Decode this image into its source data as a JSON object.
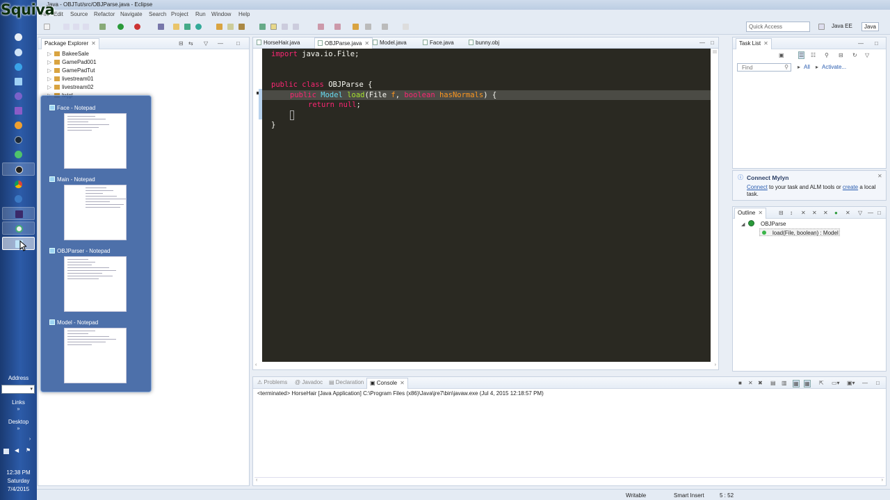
{
  "brand": "Squiva",
  "window": {
    "title": "Java - OBJTut/src/OBJParse.java - Eclipse"
  },
  "menu": [
    "File",
    "Edit",
    "Source",
    "Refactor",
    "Navigate",
    "Search",
    "Project",
    "Run",
    "Window",
    "Help"
  ],
  "toolbar": {
    "quick_access_placeholder": "Quick Access",
    "perspectives": [
      "Java EE",
      "Java"
    ]
  },
  "taskbar": {
    "address_label": "Address",
    "links_label": "Links",
    "desktop_label": "Desktop",
    "clock_time": "12:38 PM",
    "clock_day": "Saturday",
    "clock_date": "7/4/2015"
  },
  "package_explorer": {
    "title": "Package Explorer",
    "items": [
      "BakeeSale",
      "GamePad001",
      "GamePadTut",
      "livestream01",
      "livestream02",
      "lwjgl"
    ]
  },
  "peek_windows": [
    {
      "title": "Face - Notepad"
    },
    {
      "title": "Main - Notepad"
    },
    {
      "title": "OBJParser - Notepad"
    },
    {
      "title": "Model - Notepad"
    }
  ],
  "editor": {
    "tabs": [
      "HorseHair.java",
      "OBJParse.java",
      "Model.java",
      "Face.java",
      "bunny.obj"
    ],
    "active_tab": "OBJParse.java",
    "code": {
      "l1_kw": "import",
      "l1_rest": " java.io.File;",
      "l3_kw1": "public",
      "l3_kw2": " class",
      "l3_name": " OBJParse",
      "l3_rest": " {",
      "l4_kw": "public",
      "l4_type": " Model",
      "l4_fn": " load",
      "l4_p1": "(File",
      "l4_v1": " f",
      "l4_sep": ",",
      "l4_kw2": " boolean",
      "l4_v2": " hasNormals",
      "l4_end": ") {",
      "l5_kw": "return",
      "l5_kw2": " null",
      "l5_end": ";",
      "l7": "}"
    }
  },
  "task_list": {
    "title": "Task List",
    "find_placeholder": "Find",
    "all_label": "All",
    "activate_label": "Activate..."
  },
  "mylyn": {
    "title": "Connect Mylyn",
    "link_connect": "Connect",
    "text_mid": " to your task and ALM tools or ",
    "link_create": "create",
    "text_end": " a local task."
  },
  "outline": {
    "title": "Outline",
    "class_name": "OBJParse",
    "method": "load(File, boolean) : Model"
  },
  "console": {
    "tabs": [
      "Problems",
      "Javadoc",
      "Declaration",
      "Console"
    ],
    "active_tab": "Console",
    "terminated_line": "<terminated> HorseHair [Java Application] C:\\Program Files (x86)\\Java\\jre7\\bin\\javaw.exe (Jul 4, 2015 12:18:57 PM)"
  },
  "status": {
    "writable": "Writable",
    "insert_mode": "Smart Insert",
    "position": "5 : 52"
  },
  "colors": {
    "editor_bg": "#2a2922",
    "keyword": "#f92672",
    "type": "#66d9ef",
    "function": "#a6e22e",
    "variable": "#fd971f"
  }
}
